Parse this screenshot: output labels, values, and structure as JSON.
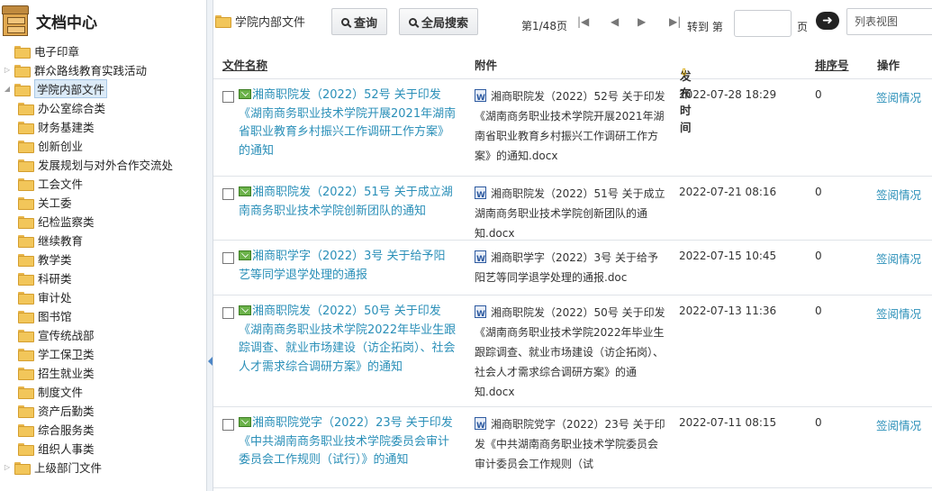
{
  "sidebar": {
    "title": "文档中心",
    "items": [
      {
        "label": "电子印章",
        "level": 1,
        "expander": ""
      },
      {
        "label": "群众路线教育实践活动",
        "level": 1,
        "expander": "▷"
      },
      {
        "label": "学院内部文件",
        "level": 1,
        "expander": "◢",
        "selected": true
      },
      {
        "label": "办公室综合类",
        "level": 2
      },
      {
        "label": "财务基建类",
        "level": 2
      },
      {
        "label": "创新创业",
        "level": 2
      },
      {
        "label": "发展规划与对外合作交流处",
        "level": 2
      },
      {
        "label": "工会文件",
        "level": 2
      },
      {
        "label": "关工委",
        "level": 2
      },
      {
        "label": "纪检监察类",
        "level": 2
      },
      {
        "label": "继续教育",
        "level": 2
      },
      {
        "label": "教学类",
        "level": 2
      },
      {
        "label": "科研类",
        "level": 2
      },
      {
        "label": "审计处",
        "level": 2
      },
      {
        "label": "图书馆",
        "level": 2
      },
      {
        "label": "宣传统战部",
        "level": 2
      },
      {
        "label": "学工保卫类",
        "level": 2
      },
      {
        "label": "招生就业类",
        "level": 2
      },
      {
        "label": "制度文件",
        "level": 2
      },
      {
        "label": "资产后勤类",
        "level": 2
      },
      {
        "label": "综合服务类",
        "level": 2
      },
      {
        "label": "组织人事类",
        "level": 2
      },
      {
        "label": "上级部门文件",
        "level": 1,
        "expander": "▷"
      }
    ]
  },
  "toolbar": {
    "breadcrumb": "学院内部文件",
    "query_label": "查询",
    "global_search_label": "全局搜索",
    "page_info": "第1/48页",
    "goto_label": "转到 第",
    "page_input_value": "",
    "page_suffix": "页",
    "go_symbol": "➜",
    "view_mode": "列表视图"
  },
  "table": {
    "headers": {
      "name": "文件名称",
      "attachment": "附件",
      "date": "发布时间",
      "sort": "排序号",
      "operation": "操作"
    },
    "rows": [
      {
        "name": "湘商职院发（2022）52号 关于印发《湖南商务职业技术学院开展2021年湖南省职业教育乡村振兴工作调研工作方案》的通知",
        "attachment": "湘商职院发（2022）52号 关于印发《湖南商务职业技术学院开展2021年湖南省职业教育乡村振兴工作调研工作方案》的通知.docx",
        "date": "2022-07-28 18:29",
        "sort": "0",
        "op": "签阅情况"
      },
      {
        "name": "湘商职院发（2022）51号 关于成立湖南商务职业技术学院创新团队的通知",
        "attachment": "湘商职院发（2022）51号 关于成立湖南商务职业技术学院创新团队的通知.docx",
        "date": "2022-07-21 08:16",
        "sort": "0",
        "op": "签阅情况"
      },
      {
        "name": "湘商职学字（2022）3号 关于给予阳艺等同学退学处理的通报",
        "attachment": "湘商职学字（2022）3号 关于给予阳艺等同学退学处理的通报.doc",
        "date": "2022-07-15 10:45",
        "sort": "0",
        "op": "签阅情况"
      },
      {
        "name": "湘商职院发（2022）50号 关于印发《湖南商务职业技术学院2022年毕业生跟踪调查、就业市场建设（访企拓岗）、社会人才需求综合调研方案》的通知",
        "attachment": "湘商职院发（2022）50号 关于印发《湖南商务职业技术学院2022年毕业生跟踪调查、就业市场建设（访企拓岗）、社会人才需求综合调研方案》的通知.docx",
        "date": "2022-07-13 11:36",
        "sort": "0",
        "op": "签阅情况"
      },
      {
        "name": "湘商职院党字（2022）23号 关于印发《中共湖南商务职业技术学院委员会审计委员会工作规则（试行）》的通知",
        "attachment": "湘商职院党字（2022）23号 关于印发《中共湖南商务职业技术学院委员会审计委员会工作规则（试",
        "date": "2022-07-11 08:15",
        "sort": "0",
        "op": "签阅情况"
      }
    ]
  }
}
